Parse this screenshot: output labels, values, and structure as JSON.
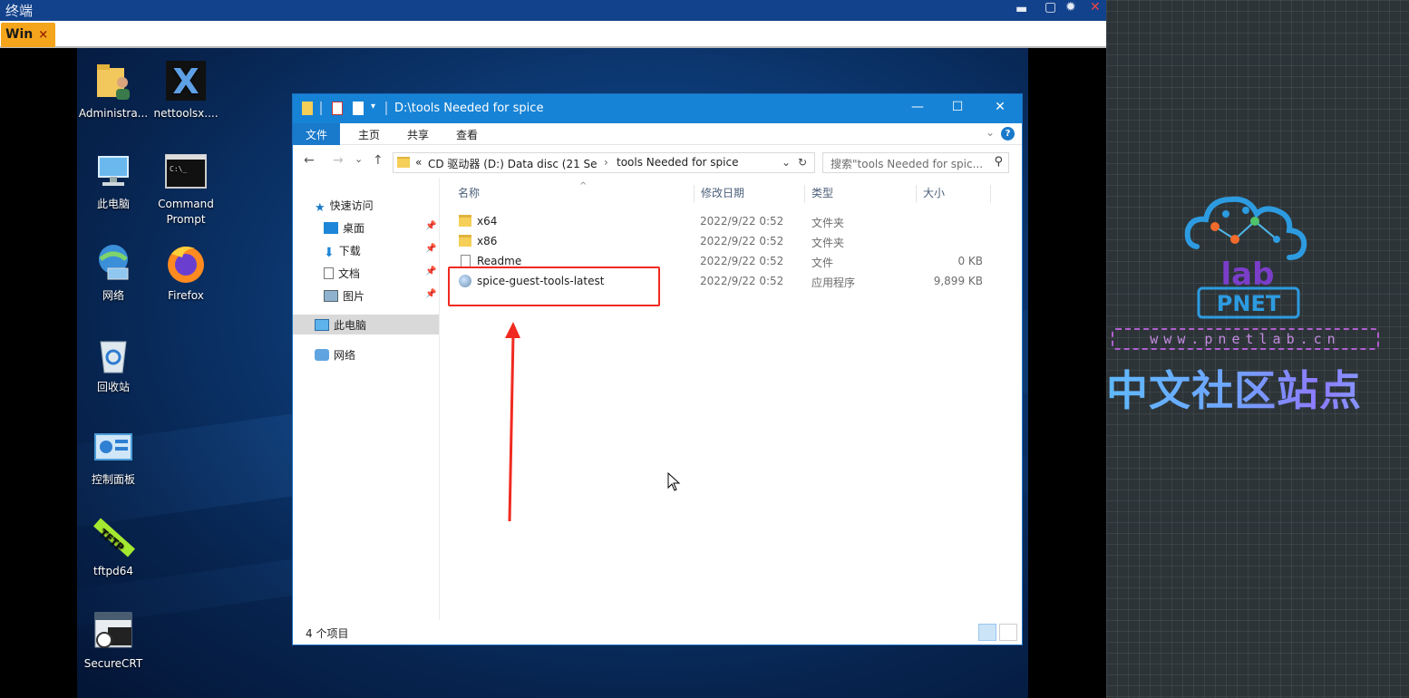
{
  "terminal": {
    "title": "终端",
    "tab_label": "Win",
    "tab_close": "×",
    "controls": {
      "minimize": "▬",
      "restore": "▢",
      "settings": "✹",
      "close": "✕"
    }
  },
  "desktop": {
    "icons": [
      {
        "label": "Administra...",
        "icon": "user-folder-icon"
      },
      {
        "label": "nettoolsx....",
        "icon": "nettools-icon"
      },
      {
        "label": "此电脑",
        "icon": "this-pc-icon"
      },
      {
        "label": "Command Prompt",
        "icon": "command-prompt-icon"
      },
      {
        "label": "网络",
        "icon": "network-icon"
      },
      {
        "label": "Firefox",
        "icon": "firefox-icon"
      },
      {
        "label": "回收站",
        "icon": "recycle-bin-icon"
      },
      {
        "label": "控制面板",
        "icon": "control-panel-icon"
      },
      {
        "label": "tftpd64",
        "icon": "tftpd64-icon"
      },
      {
        "label": "SecureCRT",
        "icon": "securecrt-icon"
      }
    ]
  },
  "explorer": {
    "title_path": "D:\\tools Needed for spice",
    "window_buttons": {
      "minimize": "—",
      "maximize": "☐",
      "close": "✕"
    },
    "ribbon_tabs": [
      "文件",
      "主页",
      "共享",
      "查看"
    ],
    "ribbon_help": "?",
    "address": {
      "prefix": "«",
      "crumb1": "CD 驱动器 (D:) Data disc (21 Se",
      "sep": "›",
      "crumb2": "tools Needed for spice",
      "dropdown": "⌄",
      "refresh": "↻"
    },
    "search_placeholder": "搜索\"tools Needed for spic...",
    "nav": {
      "back": "←",
      "forward": "→",
      "recent": "⌄",
      "up": "↑",
      "items": [
        {
          "label": "快速访问",
          "icon": "star-icon"
        },
        {
          "label": "桌面",
          "icon": "desktop-folder-icon",
          "pinned": true
        },
        {
          "label": "下载",
          "icon": "download-icon",
          "pinned": true
        },
        {
          "label": "文档",
          "icon": "documents-icon",
          "pinned": true
        },
        {
          "label": "图片",
          "icon": "pictures-icon",
          "pinned": true
        },
        {
          "label": "此电脑",
          "icon": "this-pc-icon",
          "selected": true
        },
        {
          "label": "网络",
          "icon": "network-icon"
        }
      ]
    },
    "columns": [
      "名称",
      "修改日期",
      "类型",
      "大小"
    ],
    "files": [
      {
        "name": "x64",
        "date": "2022/9/22 0:52",
        "type": "文件夹",
        "size": "",
        "icon": "folder-icon"
      },
      {
        "name": "x86",
        "date": "2022/9/22 0:52",
        "type": "文件夹",
        "size": "",
        "icon": "folder-icon"
      },
      {
        "name": "Readme",
        "date": "2022/9/22 0:52",
        "type": "文件",
        "size": "0 KB",
        "icon": "file-icon"
      },
      {
        "name": "spice-guest-tools-latest",
        "date": "2022/9/22 0:52",
        "type": "应用程序",
        "size": "9,899 KB",
        "icon": "app-icon"
      }
    ],
    "status_count": "4 个项目"
  },
  "logo": {
    "brand": "PNET",
    "lab": "lab",
    "url": "www.pnetlab.cn",
    "cn_title": "中文社区站点"
  },
  "colors": {
    "terminal_title": "#13428c",
    "tab_accent": "#f4a51c",
    "explorer_title": "#1783d6",
    "annotation": "#f02a20"
  }
}
